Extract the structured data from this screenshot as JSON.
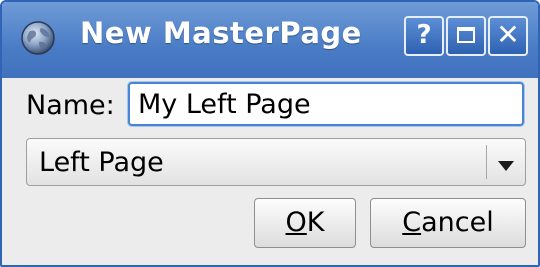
{
  "window": {
    "title": "New MasterPage",
    "help_label": "?",
    "close_label": "✕",
    "icon": "globe-icon"
  },
  "form": {
    "name_label": "Name:",
    "name_value": "My Left Page",
    "page_type_value": "Left Page"
  },
  "buttons": {
    "ok_mnemonic": "O",
    "ok_rest": "K",
    "cancel_mnemonic": "C",
    "cancel_rest": "ancel"
  },
  "colors": {
    "titlebar": "#4a7cc6",
    "window_border": "#2f65b4",
    "focus_border": "#4a84d6"
  }
}
